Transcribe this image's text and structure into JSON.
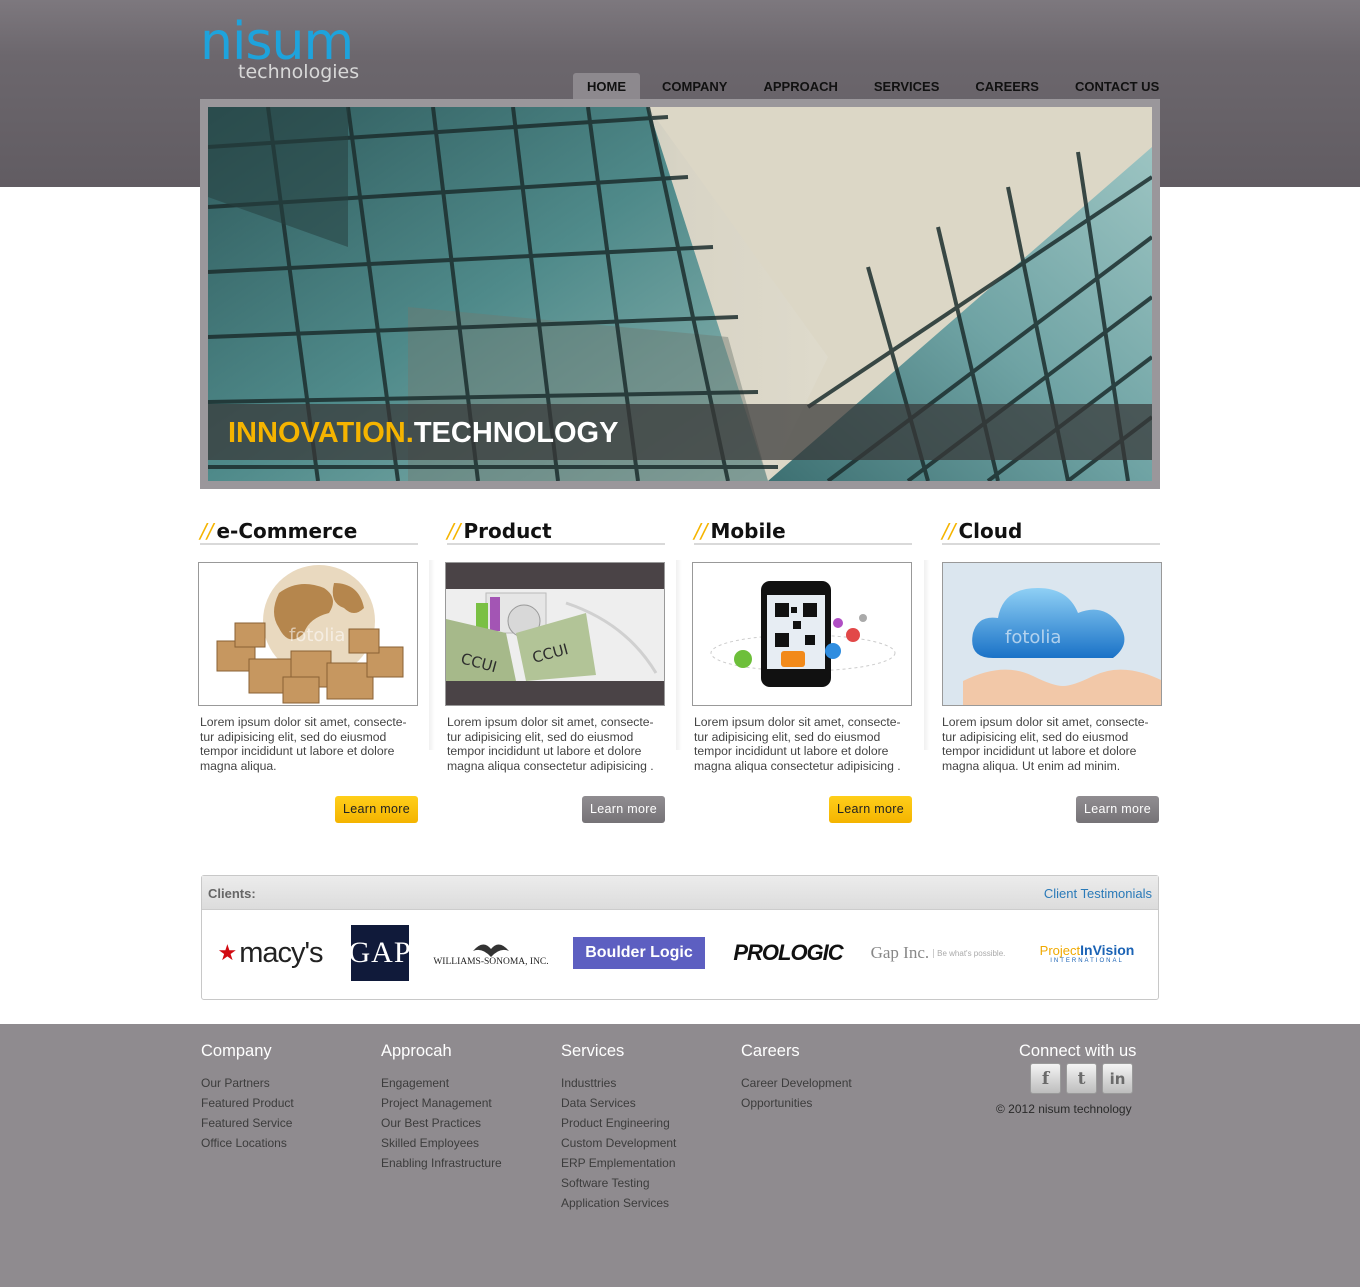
{
  "logo": {
    "main": "nisum",
    "sub": "technologies"
  },
  "nav": [
    {
      "label": "HOME",
      "active": true
    },
    {
      "label": "COMPANY"
    },
    {
      "label": "APPROACH"
    },
    {
      "label": "SERVICES"
    },
    {
      "label": "CAREERS"
    },
    {
      "label": "CONTACT US"
    }
  ],
  "hero": {
    "title_accent": "INNOVATION.",
    "title_main": "TECHNOLOGY"
  },
  "columns": [
    {
      "slash": "//",
      "title": "e-Commerce",
      "text": "Lorem ipsum dolor sit amet, consecte-tur adipisicing elit, sed do eiusmod tempor incididunt ut labore et dolore magna aliqua.",
      "button": "Learn more",
      "watermark": "fotolia"
    },
    {
      "slash": "//",
      "title": "Product",
      "text": "Lorem ipsum dolor sit amet, consecte-tur adipisicing elit, sed do eiusmod tempor incididunt ut labore et dolore magna aliqua consectetur adipisicing .",
      "button": "Learn more",
      "watermark": "CCUI"
    },
    {
      "slash": "//",
      "title": "Mobile",
      "text": "Lorem ipsum dolor sit amet, consecte-tur adipisicing elit, sed do eiusmod tempor incididunt ut labore et dolore magna aliqua consectetur adipisicing .",
      "button": "Learn more"
    },
    {
      "slash": "//",
      "title": "Cloud",
      "text": "Lorem ipsum dolor sit amet, consecte-tur adipisicing elit, sed do eiusmod tempor incididunt ut labore et dolore magna aliqua. Ut enim ad minim.",
      "button": "Learn more",
      "watermark": "fotolia"
    }
  ],
  "clients": {
    "label": "Clients:",
    "link": "Client Testimonials",
    "logos": [
      "macy's",
      "GAP",
      "WILLIAMS-SONOMA, INC.",
      "Boulder Logic",
      "PROLOGIC",
      "Gap Inc.",
      "Be what's possible.",
      "Project",
      "InVision",
      "INTERNATIONAL"
    ],
    "macys_star": "★"
  },
  "footer": {
    "company": {
      "title": "Company",
      "links": [
        "Our Partners",
        "Featured Product",
        "Featured Service",
        "Office Locations"
      ]
    },
    "approach": {
      "title": "Approcah",
      "links": [
        "Engagement",
        "Project Management",
        "Our Best Practices",
        "Skilled Employees",
        "Enabling Infrastructure"
      ]
    },
    "services": {
      "title": "Services",
      "links": [
        "Industtries",
        "Data Services",
        "Product Engineering",
        "Custom Development",
        "ERP Emplementation",
        "Software Testing",
        "Application Services"
      ]
    },
    "careers": {
      "title": "Careers",
      "links": [
        "Career Development",
        "Opportunities"
      ]
    },
    "connect": {
      "title": "Connect with us",
      "copyright": "© 2012 nisum technology",
      "icons": [
        "f",
        "t",
        "in"
      ]
    }
  },
  "colors": {
    "accent": "#f5b400",
    "brand_blue": "#1ea3dc",
    "link_blue": "#2a7ab8",
    "footer_bg": "#8f8b8f"
  }
}
